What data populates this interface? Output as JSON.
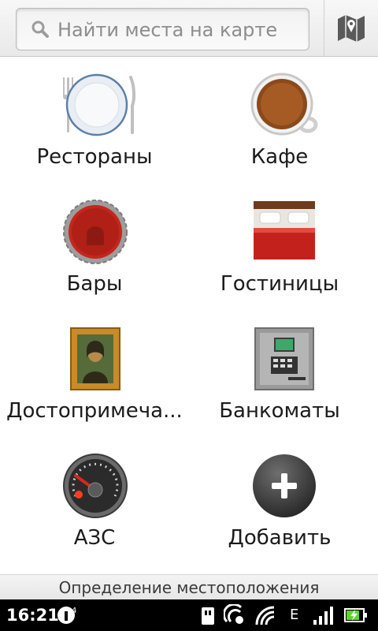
{
  "search": {
    "placeholder": "Найти места на карте"
  },
  "categories": [
    {
      "label": "Рестораны",
      "icon": "plate-icon"
    },
    {
      "label": "Кафе",
      "icon": "coffee-cup-icon"
    },
    {
      "label": "Бары",
      "icon": "bottle-cap-icon"
    },
    {
      "label": "Гостиницы",
      "icon": "bed-icon"
    },
    {
      "label": "Достопримеча...",
      "icon": "painting-icon"
    },
    {
      "label": "Банкоматы",
      "icon": "atm-icon"
    },
    {
      "label": "АЗС",
      "icon": "fuel-gauge-icon"
    },
    {
      "label": "Добавить",
      "icon": "add-icon"
    }
  ],
  "location_status": "Определение местоположения",
  "statusbar": {
    "time": "16:21",
    "network": "E"
  },
  "colors": {
    "accent_red": "#c7261c",
    "frame_gold": "#c98b2a"
  }
}
